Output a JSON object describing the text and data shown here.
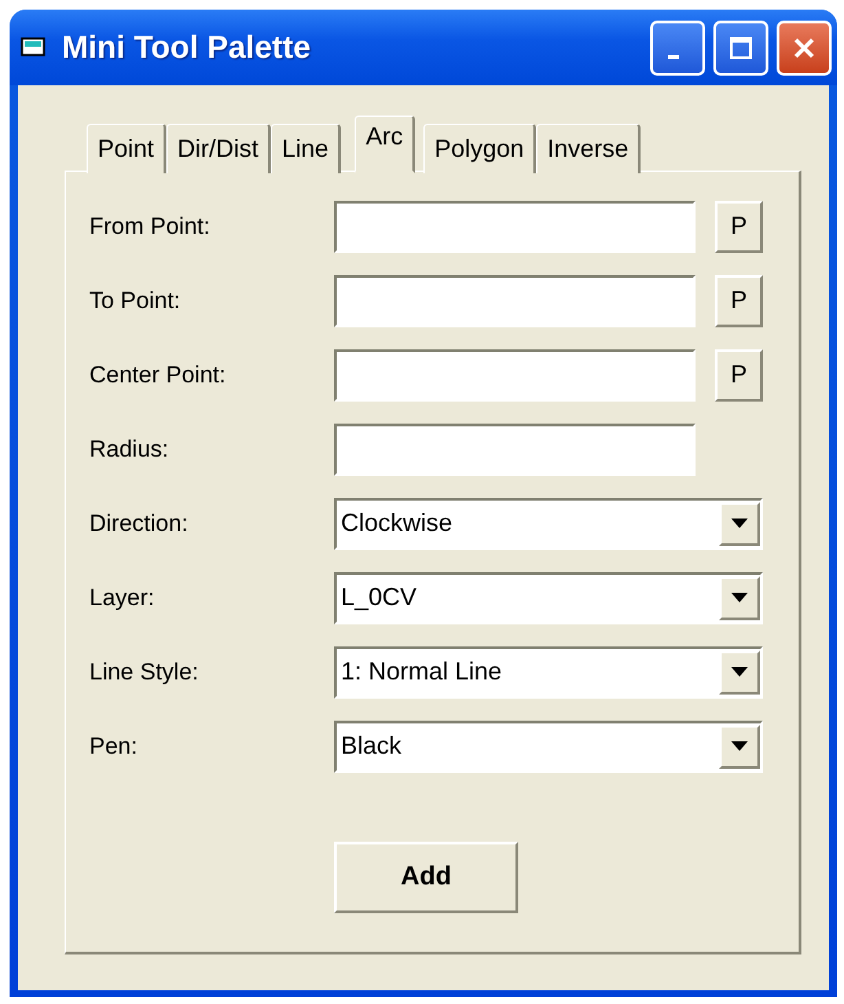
{
  "window": {
    "title": "Mini Tool Palette"
  },
  "tabs": [
    {
      "label": "Point",
      "selected": false
    },
    {
      "label": "Dir/Dist",
      "selected": false
    },
    {
      "label": "Line",
      "selected": false
    },
    {
      "label": "Arc",
      "selected": true
    },
    {
      "label": "Polygon",
      "selected": false
    },
    {
      "label": "Inverse",
      "selected": false
    }
  ],
  "fields": [
    {
      "kind": "text",
      "label": "From Point:",
      "pick_button": "P"
    },
    {
      "kind": "text",
      "label": "To Point:",
      "pick_button": "P"
    },
    {
      "kind": "text",
      "label": "Center Point:",
      "pick_button": "P"
    },
    {
      "kind": "text",
      "label": "Radius:"
    },
    {
      "kind": "dropdown",
      "label": "Direction:",
      "value": "Clockwise"
    },
    {
      "kind": "dropdown",
      "label": "Layer:",
      "value": "L_0CV"
    },
    {
      "kind": "dropdown",
      "label": "Line Style:",
      "value": "1: Normal Line"
    },
    {
      "kind": "dropdown",
      "label": "Pen:",
      "value": "Black"
    }
  ],
  "add_button": "Add"
}
